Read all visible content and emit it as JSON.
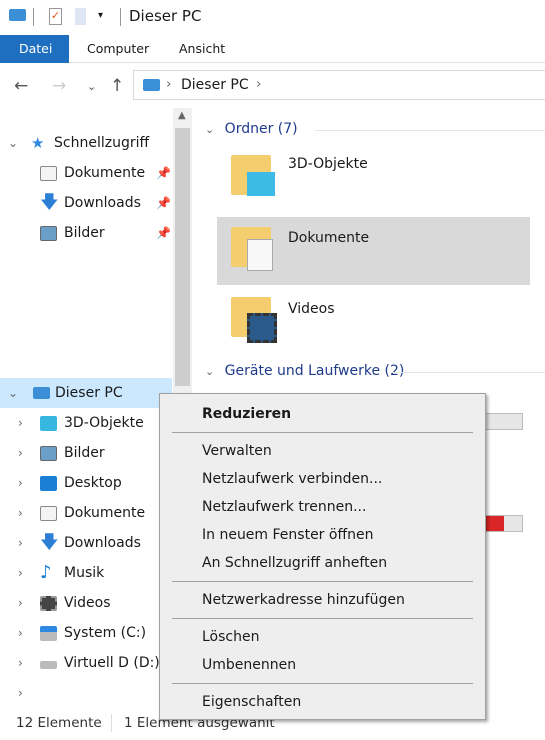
{
  "window": {
    "title": "Dieser PC"
  },
  "ribbon": {
    "tabs": [
      {
        "label": "Datei",
        "active": true
      },
      {
        "label": "Computer"
      },
      {
        "label": "Ansicht"
      }
    ]
  },
  "address": {
    "path": [
      "Dieser PC"
    ]
  },
  "nav": {
    "quick_access": {
      "label": "Schnellzugriff",
      "items": [
        {
          "label": "Dokumente",
          "icon": "document-icon"
        },
        {
          "label": "Downloads",
          "icon": "download-icon"
        },
        {
          "label": "Bilder",
          "icon": "pictures-icon"
        }
      ]
    },
    "this_pc": {
      "label": "Dieser PC",
      "items": [
        {
          "label": "3D-Objekte",
          "icon": "cube-icon"
        },
        {
          "label": "Bilder",
          "icon": "pictures-icon"
        },
        {
          "label": "Desktop",
          "icon": "desktop-icon"
        },
        {
          "label": "Dokumente",
          "icon": "document-icon"
        },
        {
          "label": "Downloads",
          "icon": "download-icon"
        },
        {
          "label": "Musik",
          "icon": "music-icon"
        },
        {
          "label": "Videos",
          "icon": "video-icon"
        },
        {
          "label": "System (C:)",
          "icon": "system-drive-icon"
        },
        {
          "label": "Virtuell D (D:)",
          "icon": "drive-icon"
        }
      ]
    }
  },
  "content": {
    "folders_header": "Ordner (7)",
    "folders": [
      {
        "label": "3D-Objekte"
      },
      {
        "label": "Dokumente",
        "selected": true
      },
      {
        "label": "Videos"
      }
    ],
    "drives_header": "Geräte und Laufwerke (2)",
    "drives": [
      {
        "used_fraction": 0.1,
        "color": "#e0e0e0"
      },
      {
        "used_fraction": 0.92,
        "color": "#da2626"
      }
    ]
  },
  "context_menu": {
    "items": [
      "Reduzieren",
      "Verwalten",
      "Netzlaufwerk verbinden...",
      "Netzlaufwerk trennen...",
      "In neuem Fenster öffnen",
      "An Schnellzugriff anheften",
      "Netzwerkadresse hinzufügen",
      "Löschen",
      "Umbenennen",
      "Eigenschaften"
    ]
  },
  "status": {
    "count": "12 Elemente",
    "selection": "1 Element ausgewählt"
  },
  "colors": {
    "accent": "#1e6fbf",
    "selection": "#cce8ff"
  }
}
